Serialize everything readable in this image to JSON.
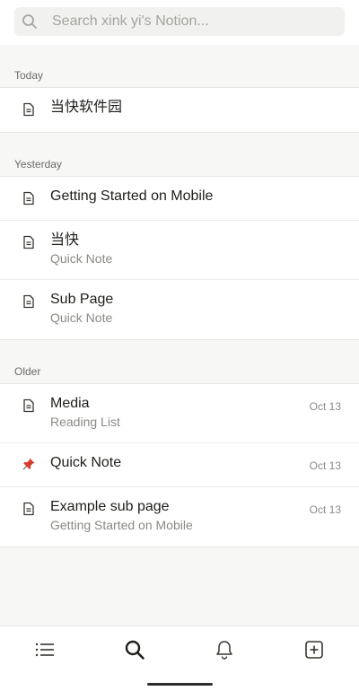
{
  "search": {
    "placeholder": "Search xink yi's Notion..."
  },
  "sections": [
    {
      "header": "Today",
      "items": [
        {
          "title": "当快软件园",
          "subtitle": "",
          "date": "",
          "icon": "page-icon"
        }
      ]
    },
    {
      "header": "Yesterday",
      "items": [
        {
          "title": "Getting Started on Mobile",
          "subtitle": "",
          "date": "",
          "icon": "page-icon"
        },
        {
          "title": "当快",
          "subtitle": "Quick Note",
          "date": "",
          "icon": "page-icon"
        },
        {
          "title": "Sub Page",
          "subtitle": "Quick Note",
          "date": "",
          "icon": "page-icon"
        }
      ]
    },
    {
      "header": "Older",
      "items": [
        {
          "title": "Media",
          "subtitle": "Reading List",
          "date": "Oct 13",
          "icon": "page-icon"
        },
        {
          "title": "Quick Note",
          "subtitle": "",
          "date": "Oct 13",
          "icon": "pushpin-icon"
        },
        {
          "title": "Example sub page",
          "subtitle": "Getting Started on Mobile",
          "date": "Oct 13",
          "icon": "page-icon"
        }
      ]
    }
  ],
  "bottom_nav": [
    "list-icon",
    "search-icon",
    "bell-icon",
    "new-page-icon"
  ],
  "colors": {
    "background": "#f7f7f5",
    "accent_text": "#1f1e1b",
    "muted_text": "#8a8985"
  }
}
